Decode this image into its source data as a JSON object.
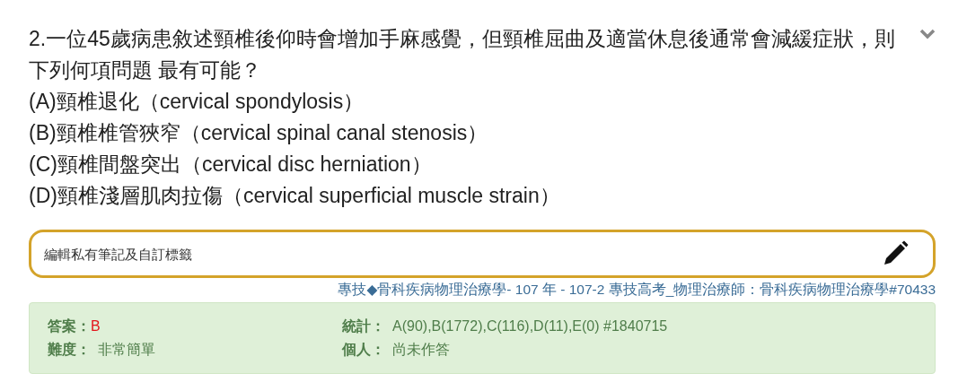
{
  "question": {
    "stem": "2.一位45歲病患敘述頸椎後仰時會增加手麻感覺，但頸椎屈曲及適當休息後通常會減緩症狀，則下列何項問題 最有可能？",
    "options": [
      "(A)頸椎退化（cervical spondylosis）",
      "(B)頸椎椎管狹窄（cervical spinal canal stenosis）",
      "(C)頸椎間盤突出（cervical disc herniation）",
      "(D)頸椎淺層肌肉拉傷（cervical superficial muscle strain）"
    ],
    "expanded": true
  },
  "note_field": {
    "placeholder": "編輯私有筆記及自訂標籤"
  },
  "source_link": "專技◆骨科疾病物理治療學- 107 年 - 107-2 專技高考_物理治療師：骨科疾病物理治療學#70433",
  "info": [
    {
      "label": "答案：",
      "value": "B",
      "kind": "answer"
    },
    {
      "label": "統計：",
      "value": "A(90),B(1772),C(116),D(11),E(0) #1840715",
      "kind": "plain"
    },
    {
      "label": "難度：",
      "value": "非常簡單",
      "kind": "plain"
    },
    {
      "label": "個人：",
      "value": "尚未作答",
      "kind": "plain"
    }
  ]
}
